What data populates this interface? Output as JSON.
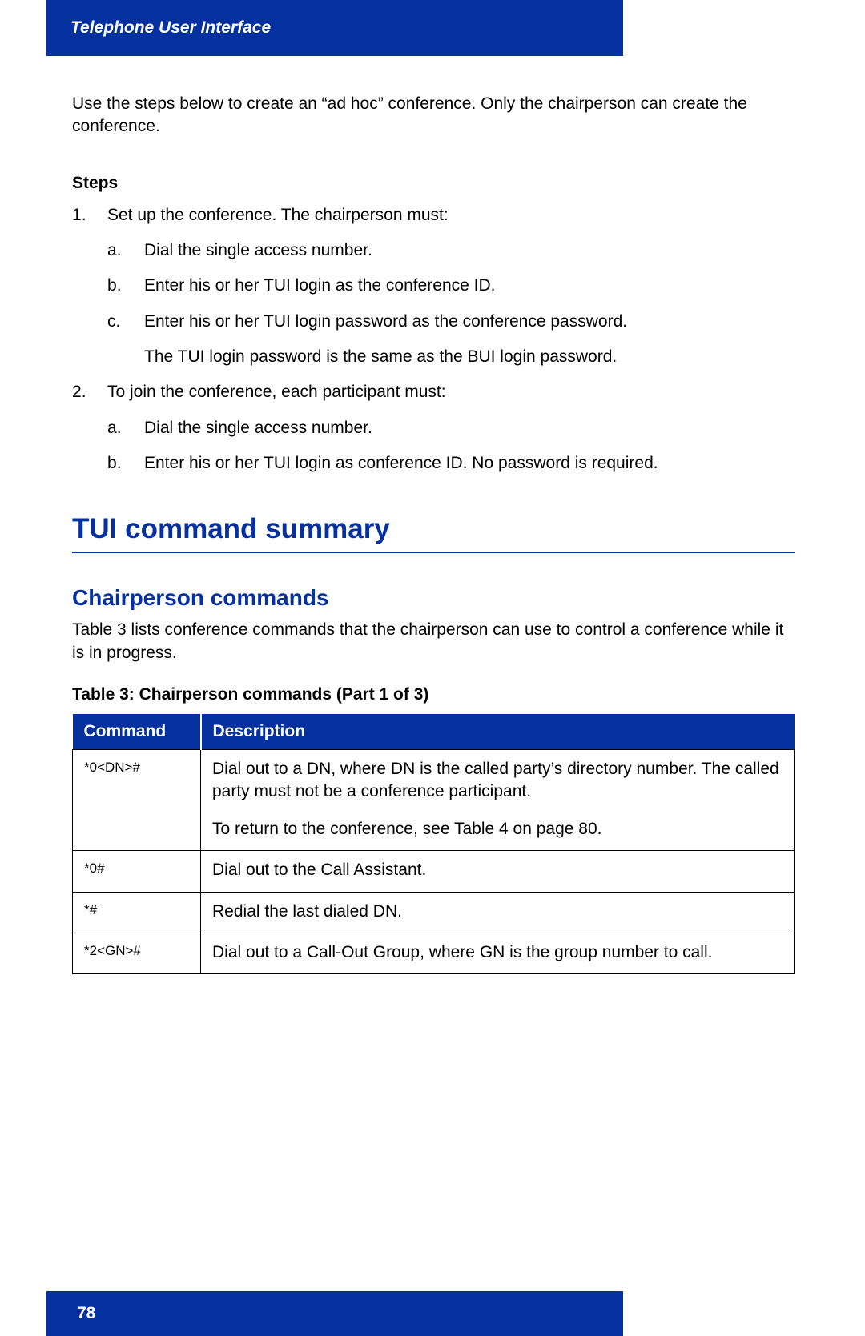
{
  "header": {
    "title": "Telephone User Interface"
  },
  "intro": "Use the steps below to create an “ad hoc” conference. Only the chairperson can create the conference.",
  "steps_heading": "Steps",
  "steps": [
    {
      "text": "Set up the conference. The chairperson must:",
      "substeps": [
        "Dial the single access number.",
        "Enter his or her TUI login as the conference ID.",
        "Enter his or her TUI login password as the conference password."
      ],
      "note": "The TUI login password is the same as the BUI login password."
    },
    {
      "text": "To join the conference, each participant must:",
      "substeps": [
        "Dial the single access number.",
        "Enter his or her TUI login as conference ID. No password is required."
      ]
    }
  ],
  "section_title": "TUI command summary",
  "subsection_title": "Chairperson commands",
  "subsection_intro": "Table 3 lists conference commands that the chairperson can use to control a conference while it is in progress.",
  "table_caption": "Table 3: Chairperson commands  (Part 1 of 3)",
  "table": {
    "headers": [
      "Command",
      "Description"
    ],
    "rows": [
      {
        "command": "*0<DN>#",
        "description": "Dial out to a DN, where DN is the called party’s directory number. The called party must not be a conference participant.",
        "description2": "To return to the conference, see Table 4 on page 80."
      },
      {
        "command": "*0#",
        "description": "Dial out to the Call Assistant."
      },
      {
        "command": "*#",
        "description": "Redial the last dialed DN."
      },
      {
        "command": "*2<GN>#",
        "description": "Dial out to a Call-Out Group, where GN is the group number to call."
      }
    ]
  },
  "page_number": "78"
}
